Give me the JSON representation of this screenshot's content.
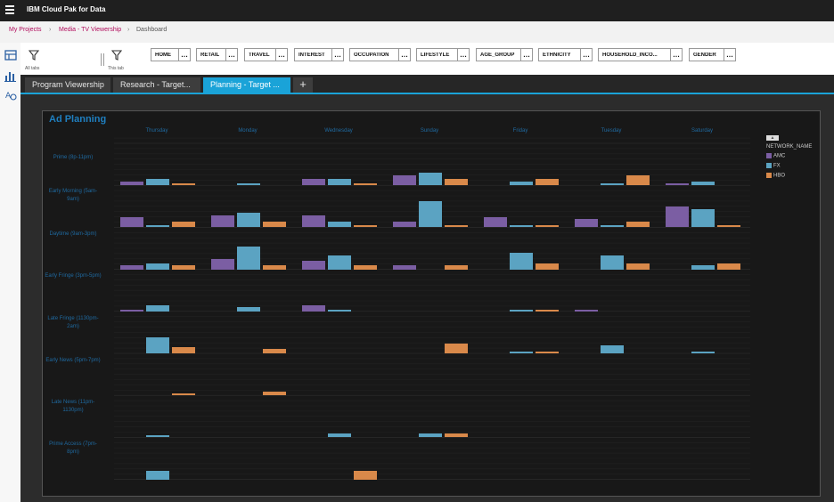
{
  "app": {
    "title": "IBM Cloud Pak for Data"
  },
  "breadcrumb": {
    "items": [
      "My Projects",
      "Media - TV Viewership",
      "Dashboard"
    ]
  },
  "filters": {
    "all_tabs_label": "All tabs",
    "this_tab_label": "This tab",
    "chips": [
      "HOME",
      "RETAIL",
      "TRAVEL",
      "INTEREST",
      "OCCUPATION",
      "LIFESTYLE",
      "AGE_GROUP",
      "ETHNICITY",
      "HOUSEHOLD_INCO...",
      "GENDER"
    ],
    "more_label": "…"
  },
  "tabs": [
    "Program Viewership",
    "Research - Target...",
    "Planning - Target ..."
  ],
  "add_tab_label": "+",
  "colors": {
    "amc": "#7b5ea3",
    "fx": "#5ba3c2",
    "hbo": "#d9894a",
    "accent": "#1aa3d8"
  },
  "chart_data": {
    "type": "bar",
    "title": "Ad Planning",
    "columns": [
      "Thursday",
      "Monday",
      "Wednesday",
      "Sunday",
      "Friday",
      "Tuesday",
      "Saturday"
    ],
    "rows": [
      "Prime (8p-11pm)",
      "Early Morning (5am-9am)",
      "Daytime (9am-3pm)",
      "Early Fringe (3pm-5pm)",
      "Late Fringe (1130pm-2am)",
      "Early News (5pm-7pm)",
      "Late News (11pm-1130pm)",
      "Prime Access (7pm-8pm)"
    ],
    "series_names": [
      "AMC",
      "FX",
      "HBO"
    ],
    "legend_title": "NETWORK_NAME",
    "legend_position": "right",
    "values": [
      [
        [
          2,
          3,
          1
        ],
        [
          0,
          1,
          0
        ],
        [
          3,
          3,
          1
        ],
        [
          5,
          6,
          3
        ],
        [
          0,
          2,
          3
        ],
        [
          0,
          1,
          5
        ],
        [
          1,
          2,
          0
        ]
      ],
      [
        [
          5,
          1,
          3
        ],
        [
          6,
          7,
          3
        ],
        [
          6,
          3,
          1
        ],
        [
          3,
          13,
          1
        ],
        [
          5,
          1,
          1
        ],
        [
          4,
          1,
          3
        ],
        [
          10,
          9,
          1
        ]
      ],
      [
        [
          2,
          3,
          2
        ],
        [
          5,
          11,
          2
        ],
        [
          4,
          7,
          2
        ],
        [
          2,
          0,
          2
        ],
        [
          0,
          8,
          3
        ],
        [
          0,
          7,
          3
        ],
        [
          0,
          2,
          3
        ]
      ],
      [
        [
          1,
          3,
          0
        ],
        [
          0,
          2,
          0
        ],
        [
          3,
          1,
          0
        ],
        [
          0,
          0,
          0
        ],
        [
          0,
          1,
          1
        ],
        [
          1,
          0,
          0
        ],
        [
          0,
          0,
          0
        ]
      ],
      [
        [
          0,
          8,
          3
        ],
        [
          0,
          0,
          2
        ],
        [
          0,
          0,
          0
        ],
        [
          0,
          0,
          5
        ],
        [
          0,
          1,
          1
        ],
        [
          0,
          4,
          0
        ],
        [
          0,
          1,
          0
        ]
      ],
      [
        [
          0,
          0,
          1
        ],
        [
          0,
          0,
          2
        ],
        [
          0,
          0,
          0
        ],
        [
          0,
          0,
          0
        ],
        [
          0,
          0,
          0
        ],
        [
          0,
          0,
          0
        ],
        [
          0,
          0,
          0
        ]
      ],
      [
        [
          0,
          1,
          0
        ],
        [
          0,
          0,
          0
        ],
        [
          0,
          2,
          0
        ],
        [
          0,
          2,
          2
        ],
        [
          0,
          0,
          0
        ],
        [
          0,
          0,
          0
        ],
        [
          0,
          0,
          0
        ]
      ],
      [
        [
          0,
          4,
          0
        ],
        [
          0,
          0,
          0
        ],
        [
          0,
          0,
          4
        ],
        [
          0,
          0,
          0
        ],
        [
          0,
          0,
          0
        ],
        [
          0,
          0,
          0
        ],
        [
          0,
          0,
          0
        ]
      ]
    ]
  }
}
